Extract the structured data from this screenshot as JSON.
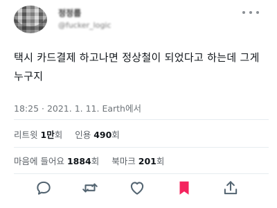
{
  "author": {
    "display_name": "정정룹",
    "handle": "@fucker_logic"
  },
  "tweet": {
    "text": "택시 카드결제 하고나면 정상철이 되었다고 하는데 그게 누구지",
    "meta": "18:25 · 2021. 1. 11. Earth에서"
  },
  "stats": {
    "retweet_label": "리트윗",
    "retweet_count": "1만",
    "retweet_unit": "회",
    "quote_label": "인용",
    "quote_count": "490",
    "quote_unit": "회",
    "like_label": "마음에 들어요",
    "like_count": "1884",
    "like_unit": "회",
    "bookmark_label": "북마크",
    "bookmark_count": "201",
    "bookmark_unit": "회"
  },
  "colors": {
    "icon_gray": "#536471",
    "bookmark_active": "#f4245e"
  },
  "icons": [
    "more-icon",
    "reply-icon",
    "retweet-icon",
    "like-icon",
    "bookmark-icon",
    "share-icon"
  ]
}
